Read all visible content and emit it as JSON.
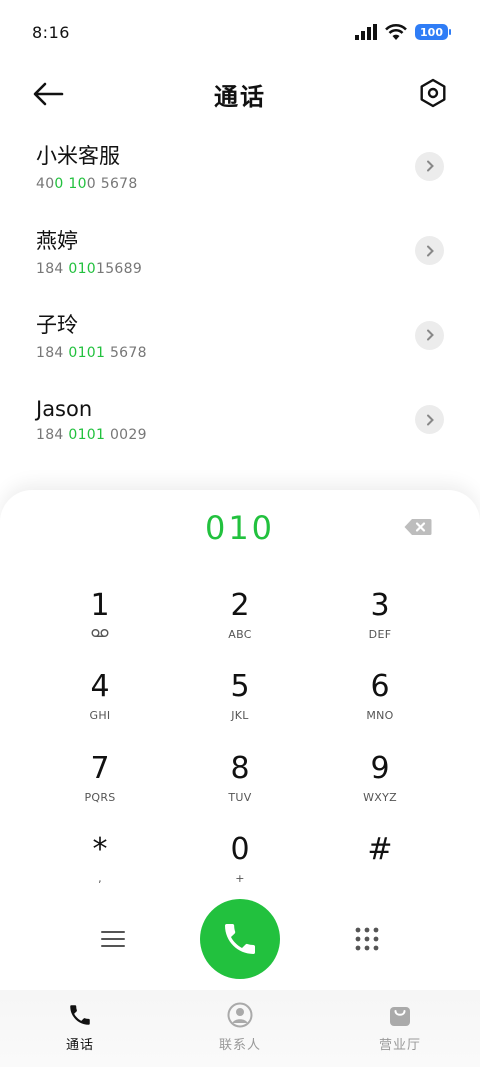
{
  "status": {
    "time": "8:16",
    "battery": "100"
  },
  "header": {
    "title": "通话"
  },
  "contacts": [
    {
      "name": "小米客服",
      "number_parts": [
        "40",
        "0 10",
        "0 5678"
      ]
    },
    {
      "name": "燕婷",
      "number_parts": [
        "184 ",
        "010",
        "15689"
      ]
    },
    {
      "name": "子玲",
      "number_parts": [
        "184 ",
        "0101",
        " 5678"
      ]
    },
    {
      "name": "Jason",
      "number_parts": [
        "184 ",
        "0101",
        " 0029"
      ]
    }
  ],
  "dialer": {
    "input": "010",
    "keys": [
      {
        "digit": "1",
        "letters": ""
      },
      {
        "digit": "2",
        "letters": "ABC"
      },
      {
        "digit": "3",
        "letters": "DEF"
      },
      {
        "digit": "4",
        "letters": "GHI"
      },
      {
        "digit": "5",
        "letters": "JKL"
      },
      {
        "digit": "6",
        "letters": "MNO"
      },
      {
        "digit": "7",
        "letters": "PQRS"
      },
      {
        "digit": "8",
        "letters": "TUV"
      },
      {
        "digit": "9",
        "letters": "WXYZ"
      },
      {
        "digit": "*",
        "letters": ","
      },
      {
        "digit": "0",
        "letters": "+"
      },
      {
        "digit": "#",
        "letters": ""
      }
    ]
  },
  "nav": [
    {
      "label": "通话",
      "icon": "phone-icon",
      "active": true
    },
    {
      "label": "联系人",
      "icon": "person-icon",
      "active": false
    },
    {
      "label": "营业厅",
      "icon": "shopping-bag-icon",
      "active": false
    }
  ],
  "colors": {
    "accent_green": "#22c13e",
    "battery_blue": "#2f7df6"
  }
}
